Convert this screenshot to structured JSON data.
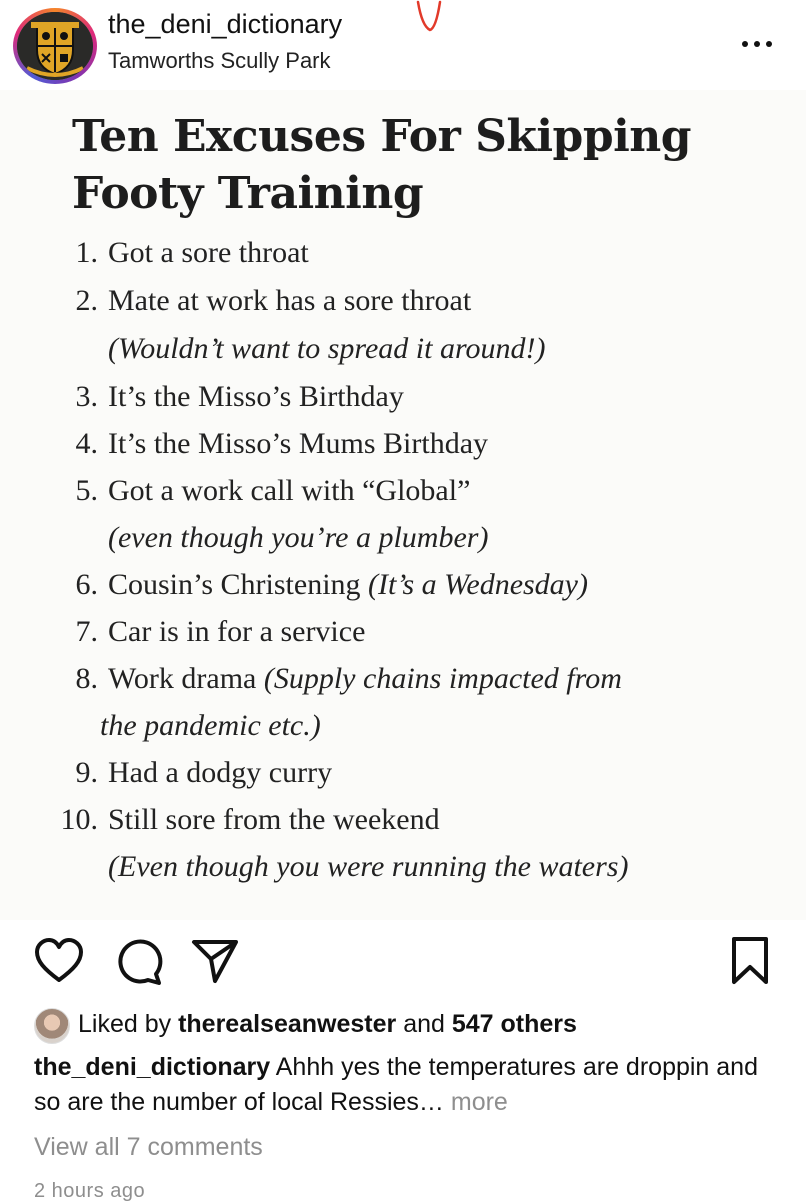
{
  "header": {
    "username": "the_deni_dictionary",
    "location": "Tamworths Scully Park",
    "avatar_icon": "club-crest-logo",
    "more_icon": "more-horizontal-icon"
  },
  "post": {
    "title_line1": "Ten Excuses For Skipping",
    "title_line2": "Footy Training",
    "excuses": [
      {
        "num": "1.",
        "text": "Got a sore throat",
        "note": ""
      },
      {
        "num": "2.",
        "text": "Mate at work has a sore throat",
        "note": ""
      },
      {
        "num": "3.",
        "text": "It’s the Misso’s Birthday",
        "note": ""
      },
      {
        "num": "4.",
        "text": "It’s the Misso’s Mums Birthday",
        "note": ""
      },
      {
        "num": "5.",
        "text": "Got a work call with “Global”",
        "note": ""
      },
      {
        "num": "6.",
        "text": "Cousin’s Christening ",
        "note": "(It’s a Wednesday)"
      },
      {
        "num": "7.",
        "text": "Car is in for a service",
        "note": ""
      },
      {
        "num": "8.",
        "text": "Work drama ",
        "note": "(Supply chains impacted from"
      },
      {
        "num": "9.",
        "text": "Had a dodgy curry",
        "note": ""
      },
      {
        "num": "10.",
        "text": "Still sore from the weekend",
        "note": ""
      }
    ],
    "continuations": {
      "c2": "(Wouldn’t want to spread it around!)",
      "c5": "(even though you’re a plumber)",
      "c8": "the pandemic etc.)",
      "c10": "(Even though you were running the waters)"
    }
  },
  "actions": {
    "like_icon": "heart-icon",
    "comment_icon": "comment-icon",
    "share_icon": "send-icon",
    "save_icon": "bookmark-icon"
  },
  "meta": {
    "liked_by_prefix": "Liked by ",
    "liked_by_user": "therealseanwester",
    "liked_and": " and ",
    "liked_others": "547 others",
    "caption_user": "the_deni_dictionary",
    "caption_text": " Ahhh yes the temperatures are droppin and so are the number of local Ressies…",
    "caption_more": " more",
    "view_comments": "View all 7 comments",
    "time": "2 hours ago"
  },
  "colors": {
    "accent_ring": "#dd2a7b",
    "muted": "#8e8e8e",
    "crest_gold": "#e0a526"
  }
}
